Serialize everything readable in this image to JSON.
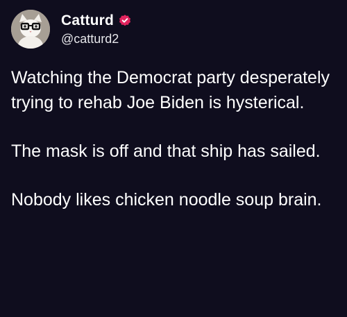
{
  "author": {
    "display_name": "Catturd",
    "handle": "@catturd2",
    "verified": true,
    "verified_badge_color": "#e0245e",
    "avatar_icon": "cat-with-glasses-avatar"
  },
  "tweet": {
    "paragraphs": [
      "Watching the Democrat party desperately trying to rehab Joe Biden is hysterical.",
      "The mask is off and that ship has sailed.",
      "Nobody likes chicken noodle soup brain."
    ]
  },
  "colors": {
    "background": "#0f0d1e",
    "text": "#ffffff"
  }
}
